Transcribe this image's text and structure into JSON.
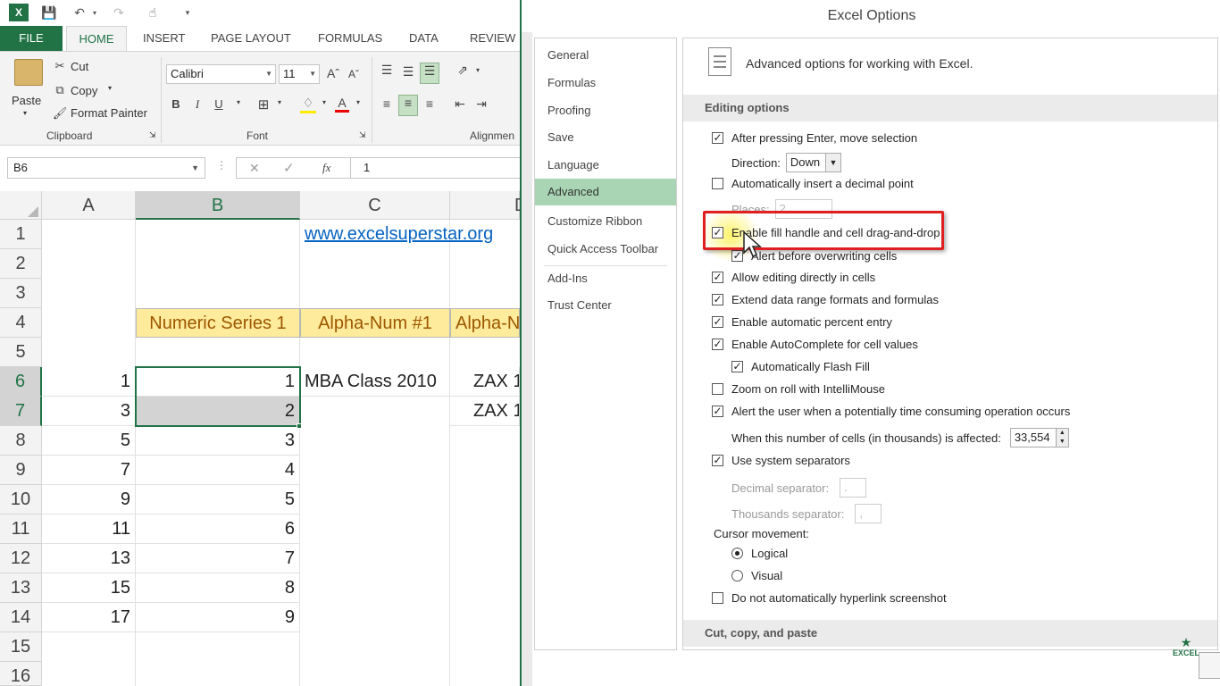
{
  "qat": {
    "excel_logo": "X"
  },
  "tabs": {
    "file": "FILE",
    "home": "HOME",
    "insert": "INSERT",
    "page_layout": "PAGE LAYOUT",
    "formulas": "FORMULAS",
    "data": "DATA",
    "review": "REVIEW"
  },
  "ribbon": {
    "paste": "Paste",
    "cut": "Cut",
    "copy": "Copy",
    "format_painter": "Format Painter",
    "clipboard": "Clipboard",
    "font_group": "Font",
    "alignment": "Alignmen",
    "font_name": "Calibri",
    "font_size": "11",
    "bold": "B",
    "italic": "I",
    "underline": "U"
  },
  "formula_bar": {
    "name_box": "B6",
    "value": "1",
    "fx": "fx"
  },
  "grid": {
    "columns": [
      "A",
      "B",
      "C",
      "D"
    ],
    "rows": [
      "1",
      "2",
      "3",
      "4",
      "5",
      "6",
      "7",
      "8",
      "9",
      "10",
      "11",
      "12",
      "13",
      "14",
      "15",
      "16"
    ],
    "link": "www.excelsuperstar.org",
    "headers": [
      "Numeric Series 1",
      "Alpha-Num #1",
      "Alpha-N"
    ],
    "colA": [
      "1",
      "3",
      "5",
      "7",
      "9",
      "11",
      "13",
      "15",
      "17"
    ],
    "colB": [
      "1",
      "2",
      "3",
      "4",
      "5",
      "6",
      "7",
      "8",
      "9"
    ],
    "c6": "MBA Class 2010",
    "d6": "ZAX 1",
    "d7": "ZAX 1"
  },
  "dialog": {
    "title": "Excel Options",
    "nav": [
      "General",
      "Formulas",
      "Proofing",
      "Save",
      "Language",
      "Advanced",
      "Customize Ribbon",
      "Quick Access Toolbar",
      "Add-Ins",
      "Trust Center"
    ],
    "header": "Advanced options for working with Excel.",
    "section_editing": "Editing options",
    "section_cut": "Cut, copy, and paste",
    "opt_after_enter": "After pressing Enter, move selection",
    "direction_label": "Direction:",
    "direction_value": "Down",
    "opt_decimal": "Automatically insert a decimal point",
    "places_label": "Places:",
    "places_value": "2",
    "opt_fill": "Enable fill handle and cell drag-and-drop",
    "opt_alert_overwrite": "Alert before overwriting cells",
    "opt_edit_directly": "Allow editing directly in cells",
    "opt_extend": "Extend data range formats and formulas",
    "opt_percent": "Enable automatic percent entry",
    "opt_autocomplete": "Enable AutoComplete for cell values",
    "opt_flash": "Automatically Flash Fill",
    "opt_zoom": "Zoom on roll with IntelliMouse",
    "opt_alert_time": "Alert the user when a potentially time consuming operation occurs",
    "cells_label": "When this number of cells (in thousands) is affected:",
    "cells_value": "33,554",
    "opt_separators": "Use system separators",
    "decimal_sep": "Decimal separator:",
    "decimal_sep_value": ".",
    "thousands_sep": "Thousands separator:",
    "thousands_sep_value": ",",
    "cursor_label": "Cursor movement:",
    "logical": "Logical",
    "visual": "Visual",
    "opt_hyperlink": "Do not automatically hyperlink screenshot",
    "watermark": "EXCEL"
  },
  "colors": {
    "excel_green": "#217346",
    "highlight_red": "#e02020",
    "header_fill": "#ffeb9c",
    "header_text": "#9c5700"
  }
}
